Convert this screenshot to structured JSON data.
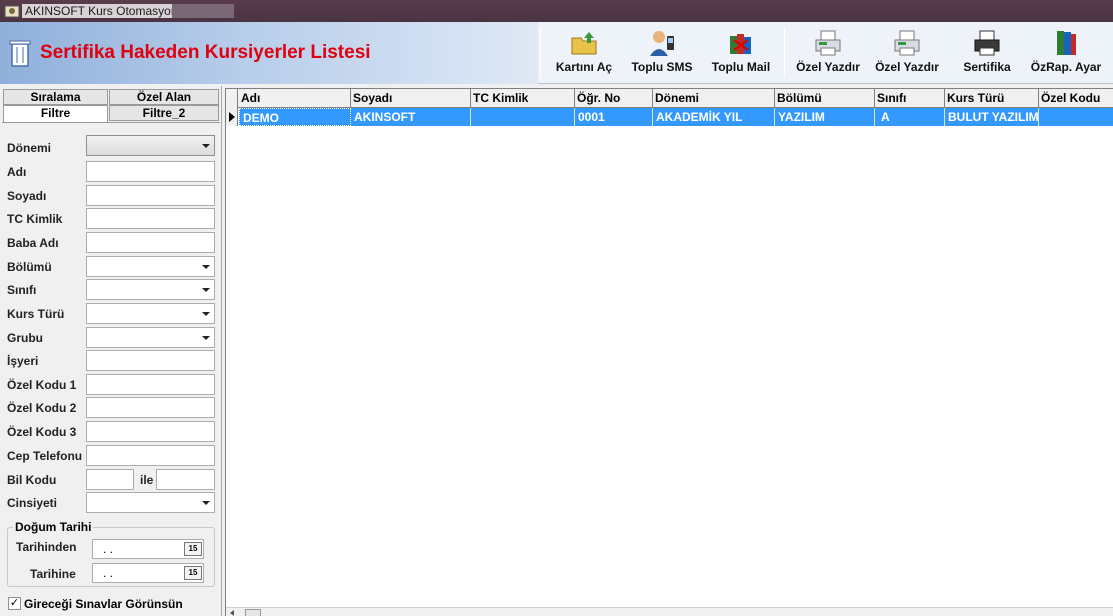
{
  "window": {
    "title": "AKINSOFT Kurs Otomasyonu s"
  },
  "header": {
    "title": "Sertifika Hakeden Kursiyerler Listesi"
  },
  "toolbar": {
    "buttons": [
      {
        "label": "Kartını Aç",
        "icon": "folder-open-icon"
      },
      {
        "label": "Toplu SMS",
        "icon": "user-phone-icon"
      },
      {
        "label": "Toplu Mail",
        "icon": "mail-books-icon"
      },
      {
        "label": "Özel Yazdır",
        "icon": "printer-icon"
      },
      {
        "label": "Özel Yazdır",
        "icon": "printer-icon"
      },
      {
        "label": "Sertifika",
        "icon": "printer-dark-icon"
      },
      {
        "label": "ÖzRap. Ayar",
        "icon": "books-icon"
      }
    ]
  },
  "tabs": {
    "siralama": "Sıralama",
    "ozel_alan": "Özel Alan",
    "filtre": "Filtre",
    "filtre_2": "Filtre_2"
  },
  "filters": {
    "donemi": "Dönemi",
    "adi": "Adı",
    "soyadi": "Soyadı",
    "tc_kimlik": "TC Kimlik",
    "baba_adi": "Baba Adı",
    "bolumu": "Bölümü",
    "sinifi": "Sınıfı",
    "kurs_turu": "Kurs Türü",
    "grubu": "Grubu",
    "isyeri": "İşyeri",
    "ozel_kodu_1": "Özel Kodu 1",
    "ozel_kodu_2": "Özel Kodu 2",
    "ozel_kodu_3": "Özel Kodu 3",
    "cep_telefonu": "Cep Telefonu",
    "bil_kodu": "Bil Kodu",
    "ile": "ile",
    "cinsiyeti": "Cinsiyeti"
  },
  "dogum_tarihi": {
    "title": "Doğum Tarihi",
    "tarihinden": "Tarihinden",
    "tarihine": "Tarihine",
    "date_placeholder": ". .",
    "calendar_label": "15"
  },
  "checkbox": {
    "label": "Gireceği Sınavlar Görünsün",
    "checked": true,
    "mark": "✓"
  },
  "grid": {
    "columns": [
      "Adı",
      "Soyadı",
      "TC Kimlik",
      "Öğr. No",
      "Dönemi",
      "Bölümü",
      "Sınıfı",
      "Kurs Türü",
      "Özel Kodu"
    ],
    "rows": [
      [
        "DEMO",
        "AKINSOFT",
        "",
        "0001",
        "AKADEMİK YIL",
        "YAZILIM",
        "A",
        "BULUT YAZILIM",
        ""
      ]
    ]
  },
  "colors": {
    "title_red": "#e00010",
    "selection_blue": "#3399ff"
  }
}
